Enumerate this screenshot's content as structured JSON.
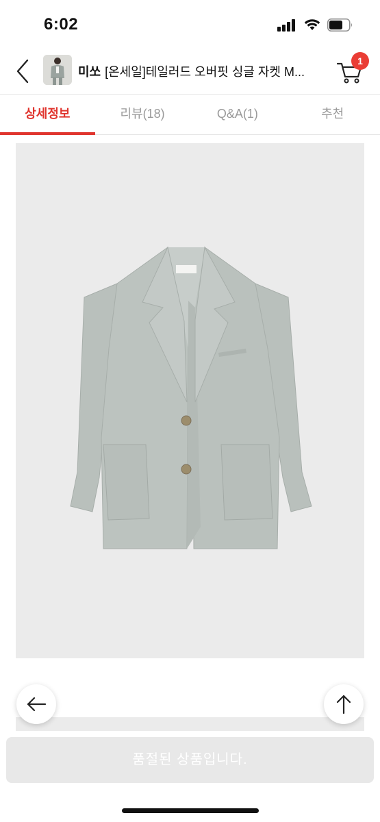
{
  "status_bar": {
    "time": "6:02"
  },
  "header": {
    "brand": "미쏘",
    "title": "[온세일]테일러드 오버핏 싱글 자켓 M...",
    "cart_count": "1"
  },
  "tabs": [
    {
      "label": "상세정보",
      "active": true
    },
    {
      "label": "리뷰(18)",
      "active": false
    },
    {
      "label": "Q&A(1)",
      "active": false
    },
    {
      "label": "추천",
      "active": false
    }
  ],
  "product_image": {
    "label_text": "MIXXO",
    "jacket_color": "#b8bfbb",
    "background_color": "#ebebeb"
  },
  "buttons": {
    "soldout_label": "품절된 상품입니다."
  },
  "colors": {
    "accent": "#e0352e",
    "badge": "#ea3d35",
    "disabled_bg": "#e8e8e8"
  }
}
